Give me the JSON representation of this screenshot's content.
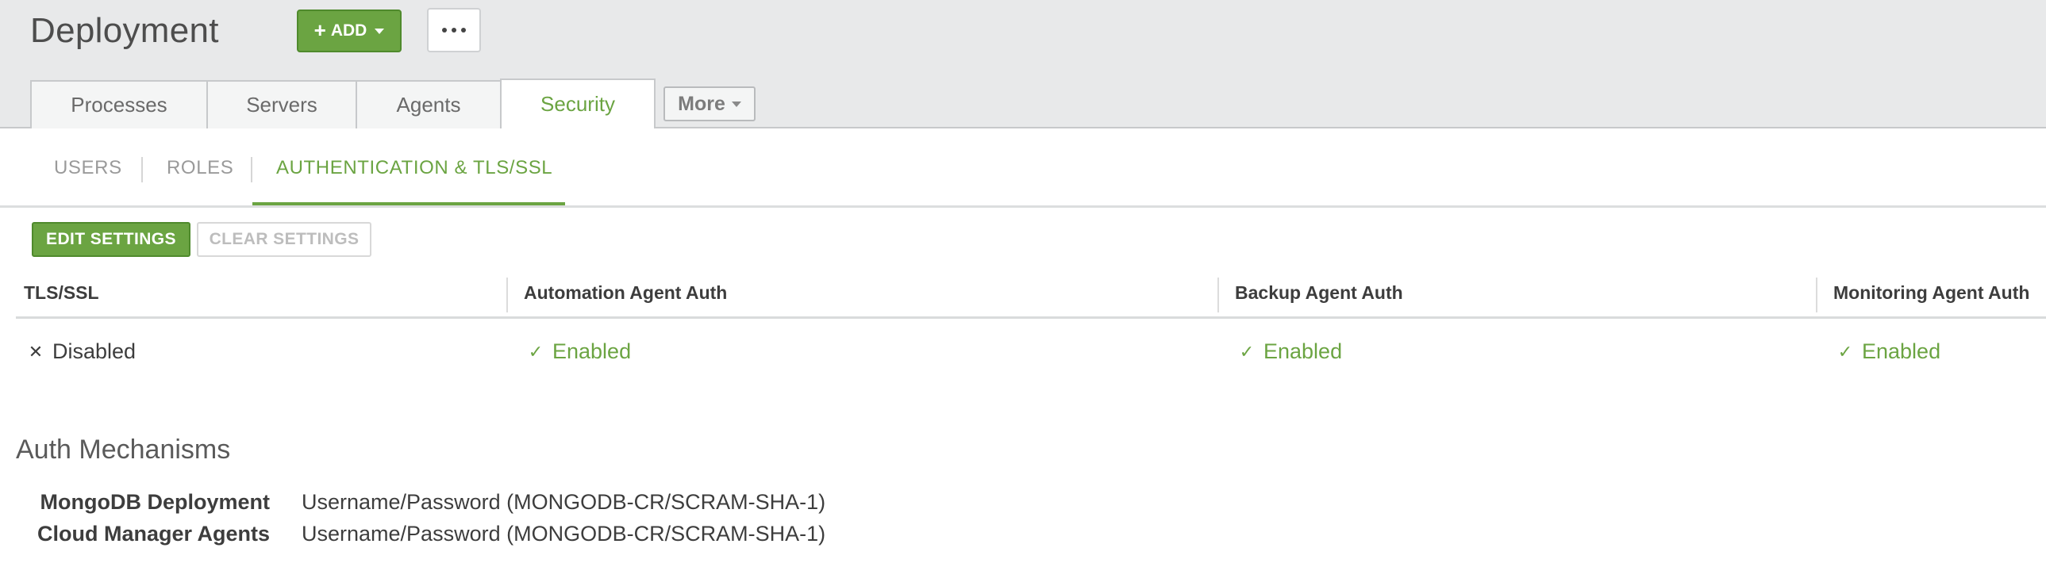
{
  "header": {
    "title": "Deployment",
    "add_label": "ADD",
    "accent_color": "#6ba442"
  },
  "tabs": [
    {
      "label": "Processes",
      "active": false
    },
    {
      "label": "Servers",
      "active": false
    },
    {
      "label": "Agents",
      "active": false
    },
    {
      "label": "Security",
      "active": true
    }
  ],
  "more_tab": {
    "label": "More"
  },
  "subtabs": [
    {
      "label": "USERS",
      "active": false
    },
    {
      "label": "ROLES",
      "active": false
    },
    {
      "label": "AUTHENTICATION & TLS/SSL",
      "active": true
    }
  ],
  "actions": {
    "edit_label": "EDIT SETTINGS",
    "clear_label": "CLEAR SETTINGS"
  },
  "table": {
    "headers": [
      "TLS/SSL",
      "Automation Agent Auth",
      "Backup Agent Auth",
      "Monitoring Agent Auth"
    ],
    "cells": [
      {
        "icon": "x-icon",
        "text": "Disabled",
        "enabled": false
      },
      {
        "icon": "check-icon",
        "text": "Enabled",
        "enabled": true
      },
      {
        "icon": "check-icon",
        "text": "Enabled",
        "enabled": true
      },
      {
        "icon": "check-icon",
        "text": "Enabled",
        "enabled": true
      }
    ]
  },
  "auth_mechanisms": {
    "title": "Auth Mechanisms",
    "rows": [
      {
        "label": "MongoDB Deployment",
        "value": "Username/Password (MONGODB-CR/SCRAM-SHA-1)"
      },
      {
        "label": "Cloud Manager Agents",
        "value": "Username/Password (MONGODB-CR/SCRAM-SHA-1)"
      }
    ]
  }
}
